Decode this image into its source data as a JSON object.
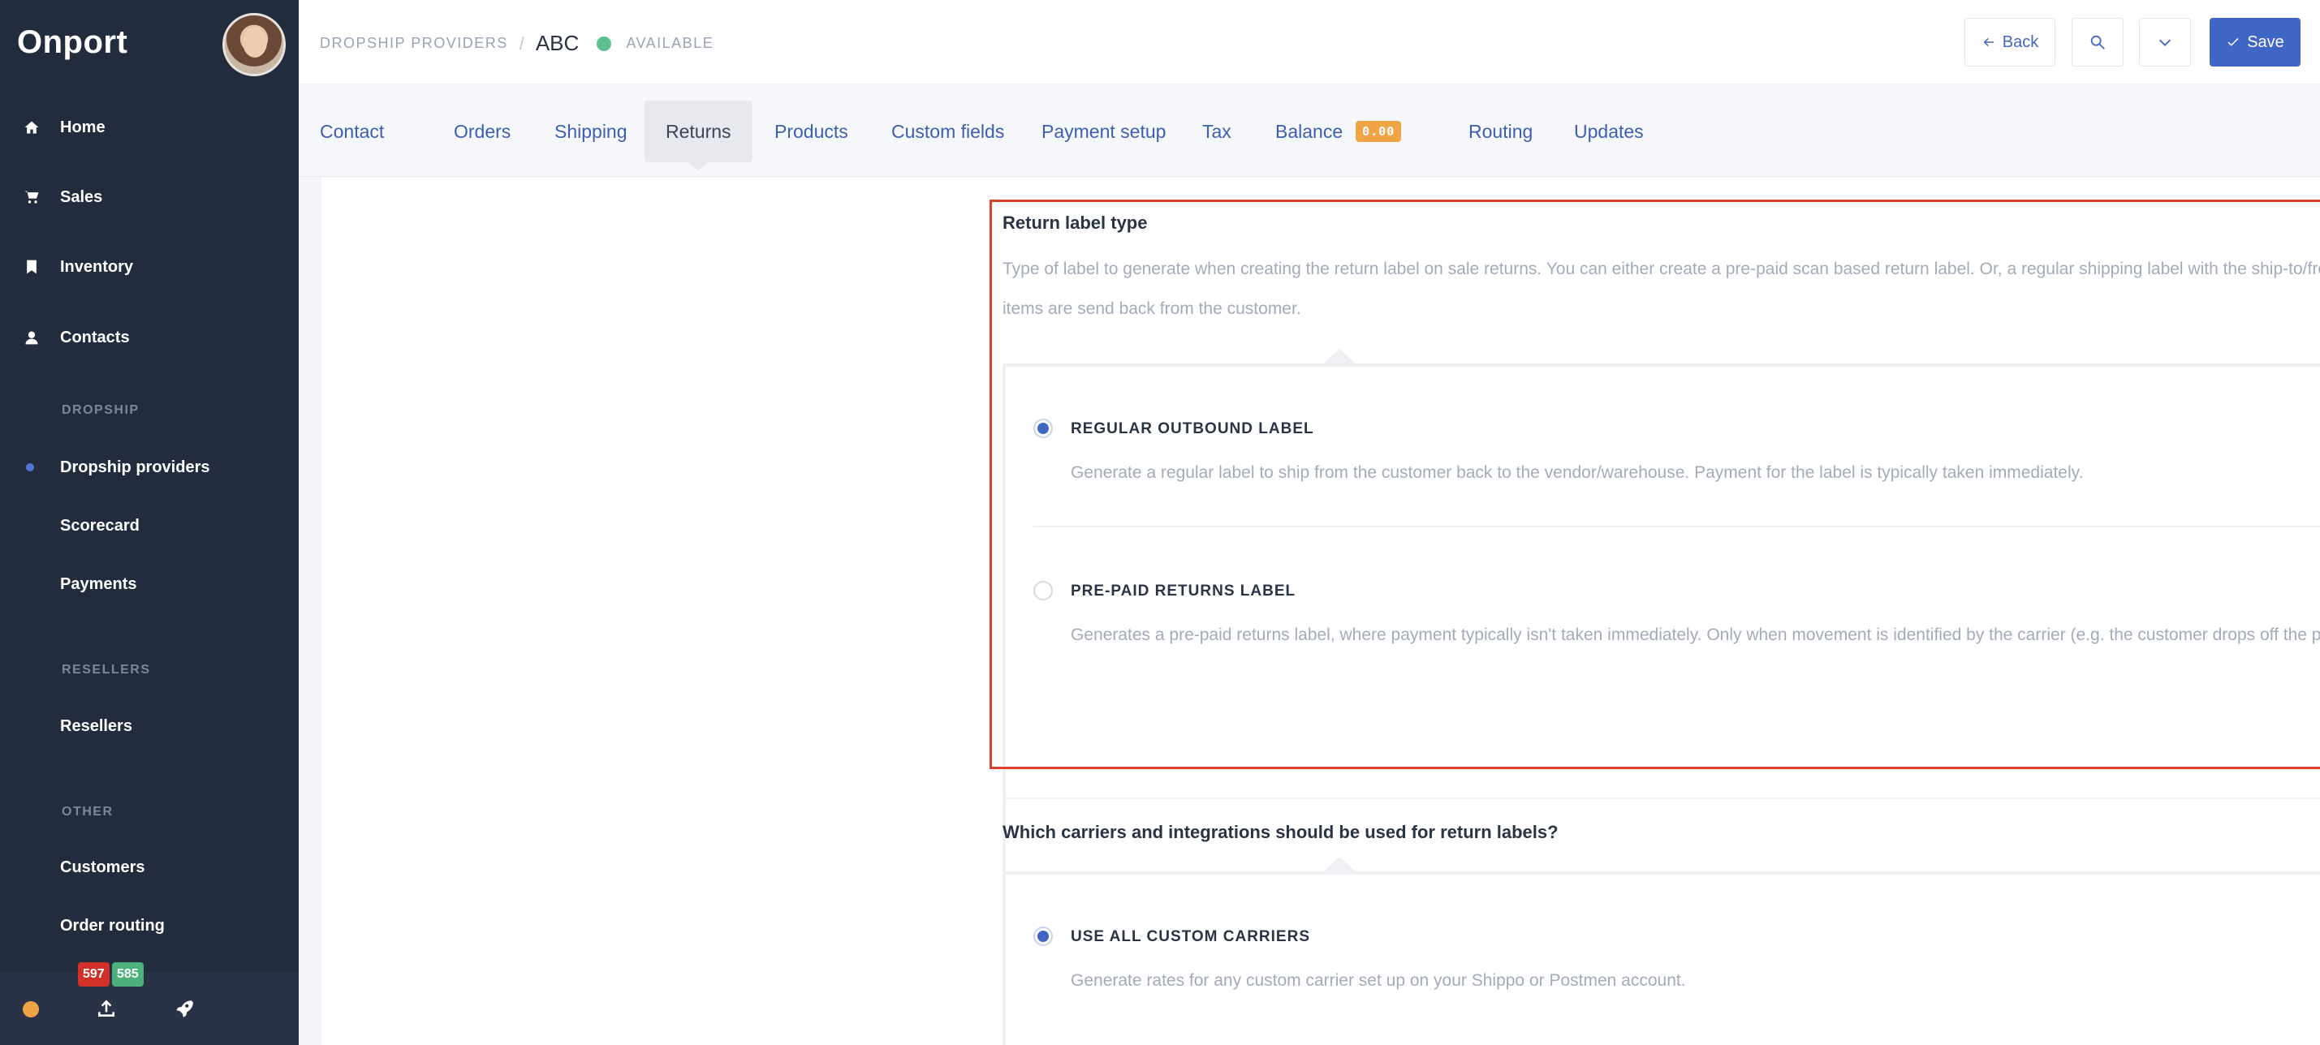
{
  "sidebar": {
    "brand": "Onport",
    "main_items": [
      {
        "label": "Home",
        "icon": "home-icon"
      },
      {
        "label": "Sales",
        "icon": "cart-icon"
      },
      {
        "label": "Inventory",
        "icon": "bookmark-icon"
      },
      {
        "label": "Contacts",
        "icon": "person-icon"
      }
    ],
    "sections": {
      "dropship": "DROPSHIP",
      "resellers": "RESELLERS",
      "other": "OTHER"
    },
    "dropship_items": [
      "Dropship providers",
      "Scorecard",
      "Payments"
    ],
    "resellers_items": [
      "Resellers"
    ],
    "other_items": [
      "Customers",
      "Order routing"
    ],
    "footer": {
      "badge_red": "597",
      "badge_green": "585",
      "status_color": "#f0a545"
    }
  },
  "header": {
    "breadcrumb_parent": "DROPSHIP PROVIDERS",
    "breadcrumb_sep": "/",
    "title": "ABC",
    "status": "AVAILABLE",
    "back_label": "Back",
    "save_label": "Save"
  },
  "tabs": {
    "items": [
      "Contact",
      "Orders",
      "Shipping",
      "Returns",
      "Products",
      "Custom fields",
      "Payment setup",
      "Tax",
      "Balance",
      "Routing",
      "Updates"
    ],
    "active": "Returns",
    "balance_badge": "0.00"
  },
  "returns": {
    "label_type": {
      "title": "Return label type",
      "description": "Type of label to generate when creating the return label on sale returns. You can either create a pre-paid scan based return label. Or, a regular shipping label with the ship-to/from addresses switched, so the items are send back from the customer.",
      "options": [
        {
          "label": "REGULAR OUTBOUND LABEL",
          "description": "Generate a regular label to ship from the customer back to the vendor/warehouse. Payment for the label is typically taken immediately.",
          "selected": true
        },
        {
          "label": "PRE-PAID RETURNS LABEL",
          "description": "Generates a pre-paid returns label, where payment typically isn't taken immediately. Only when movement is identified by the carrier (e.g. the customer drops off the parcel with the carrier).",
          "selected": false
        }
      ]
    },
    "carriers": {
      "title": "Which carriers and integrations should be used for return labels?",
      "options": [
        {
          "label": "USE ALL CUSTOM CARRIERS",
          "description": "Generate rates for any custom carrier set up on your Shippo or Postmen account.",
          "selected": true
        }
      ]
    }
  },
  "colors": {
    "sidebar_bg": "#232c3d",
    "accent": "#3f66c5",
    "highlight": "#d9412d",
    "available": "#5fc08f",
    "balance_badge": "#f0a545"
  }
}
